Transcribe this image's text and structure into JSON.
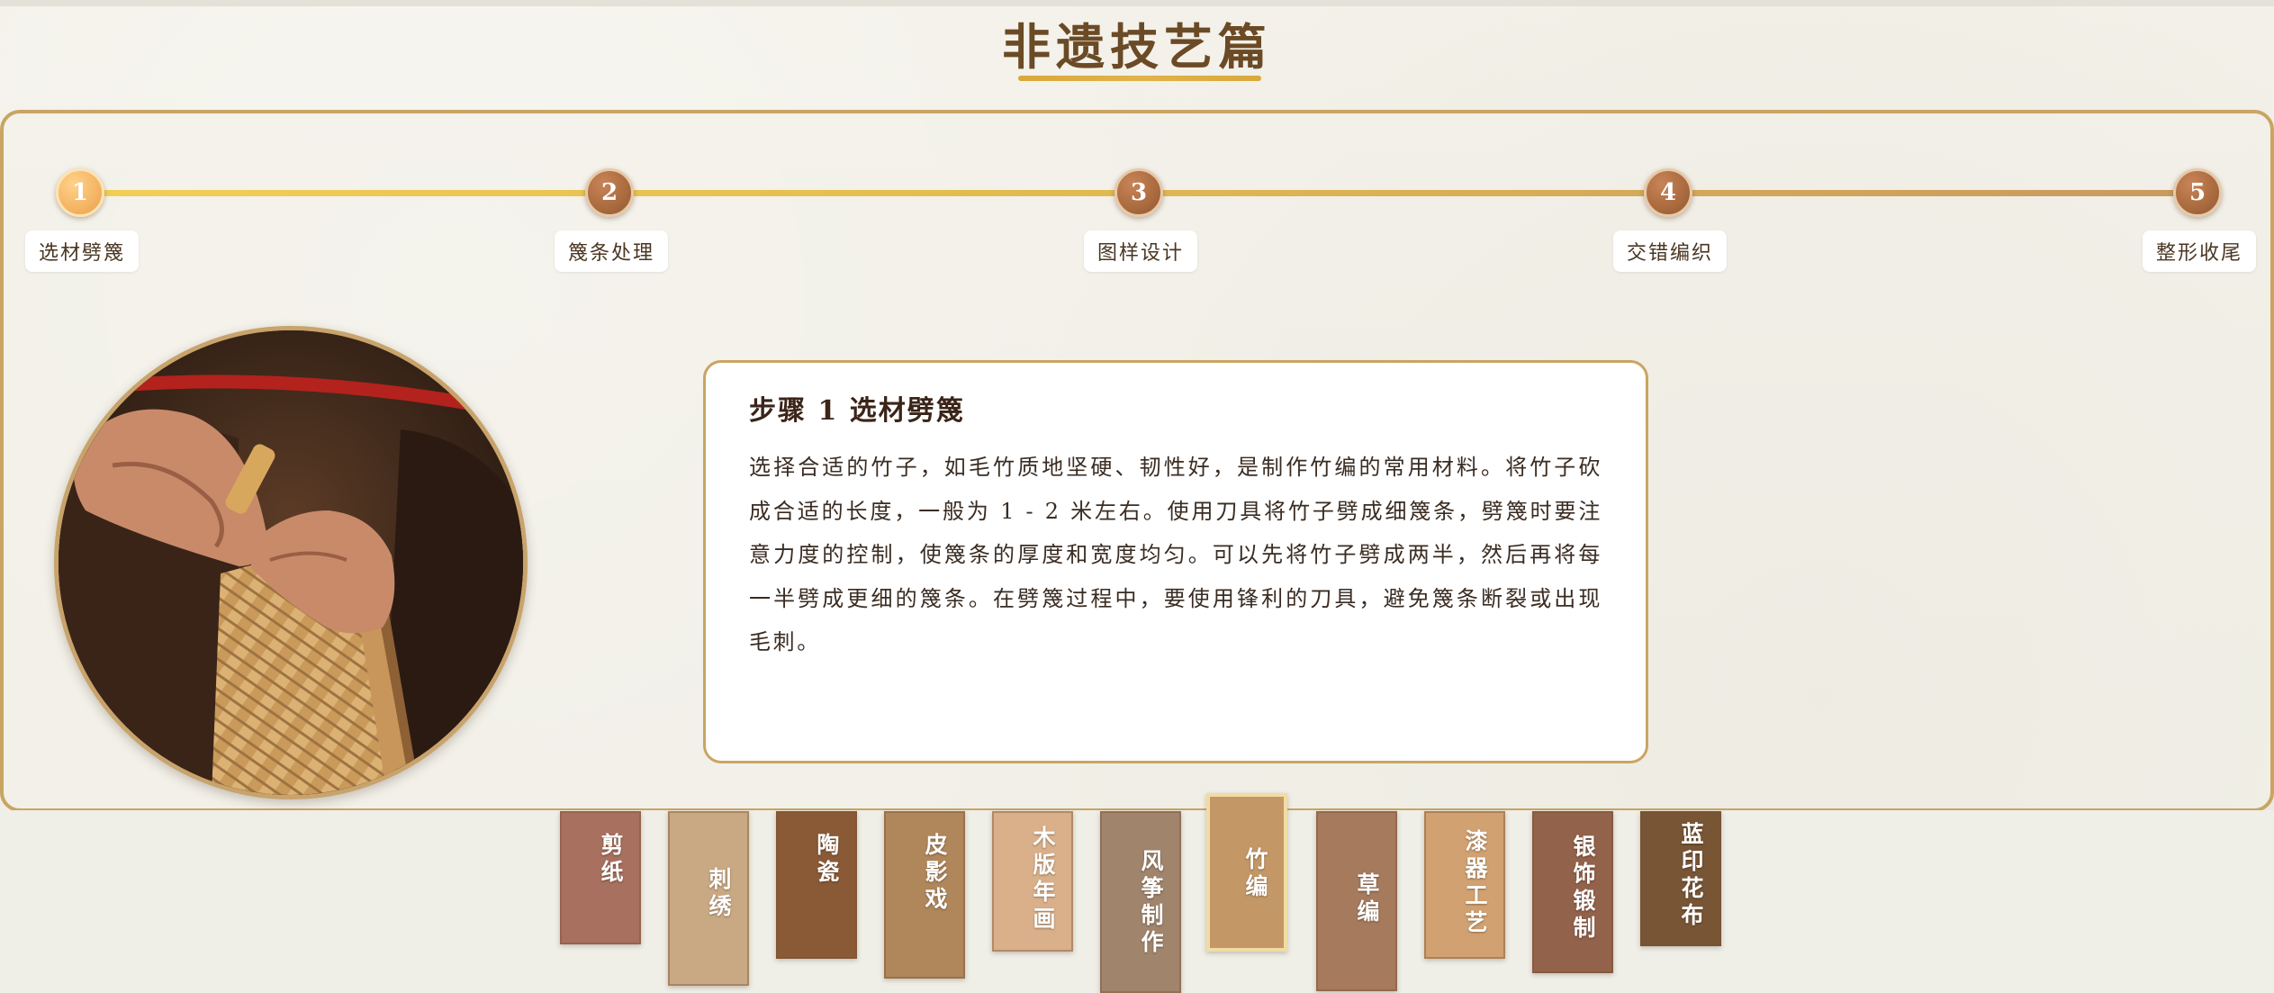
{
  "page": {
    "title": "非遗技艺篇"
  },
  "timeline": {
    "steps": [
      {
        "number": "1",
        "label": "选材劈篾"
      },
      {
        "number": "2",
        "label": "篾条处理"
      },
      {
        "number": "3",
        "label": "图样设计"
      },
      {
        "number": "4",
        "label": "交错编织"
      },
      {
        "number": "5",
        "label": "整形收尾"
      }
    ],
    "active_step": 1
  },
  "content": {
    "title": "步骤 1 选材劈篾",
    "body": "选择合适的竹子，如毛竹质地坚硬、韧性好，是制作竹编的常用材料。将竹子砍成合适的长度，一般为 1 - 2 米左右。使用刀具将竹子劈成细篾条，劈篾时要注意力度的控制，使篾条的厚度和宽度均匀。可以先将竹子劈成两半，然后再将每一半劈成更细的篾条。在劈篾过程中，要使用锋利的刀具，避免篾条断裂或出现毛刺。"
  },
  "crafts": {
    "items": [
      {
        "label": "剪纸",
        "color": "#a8705e"
      },
      {
        "label": "刺绣",
        "color": "#c9a983"
      },
      {
        "label": "陶瓷",
        "color": "#8a5a36"
      },
      {
        "label": "皮影戏",
        "color": "#b0875b"
      },
      {
        "label": "木版年画",
        "color": "#d9b08a"
      },
      {
        "label": "风筝制作",
        "color": "#a0846c"
      },
      {
        "label": "竹编",
        "color": "#c49866"
      },
      {
        "label": "草编",
        "color": "#a57a5d"
      },
      {
        "label": "漆器工艺",
        "color": "#d1a171"
      },
      {
        "label": "银饰锻制",
        "color": "#93624b"
      },
      {
        "label": "蓝印花布",
        "color": "#775535"
      }
    ],
    "active": "竹编"
  },
  "icons": {
    "photo": "bamboo-weaving-hands-photo"
  }
}
